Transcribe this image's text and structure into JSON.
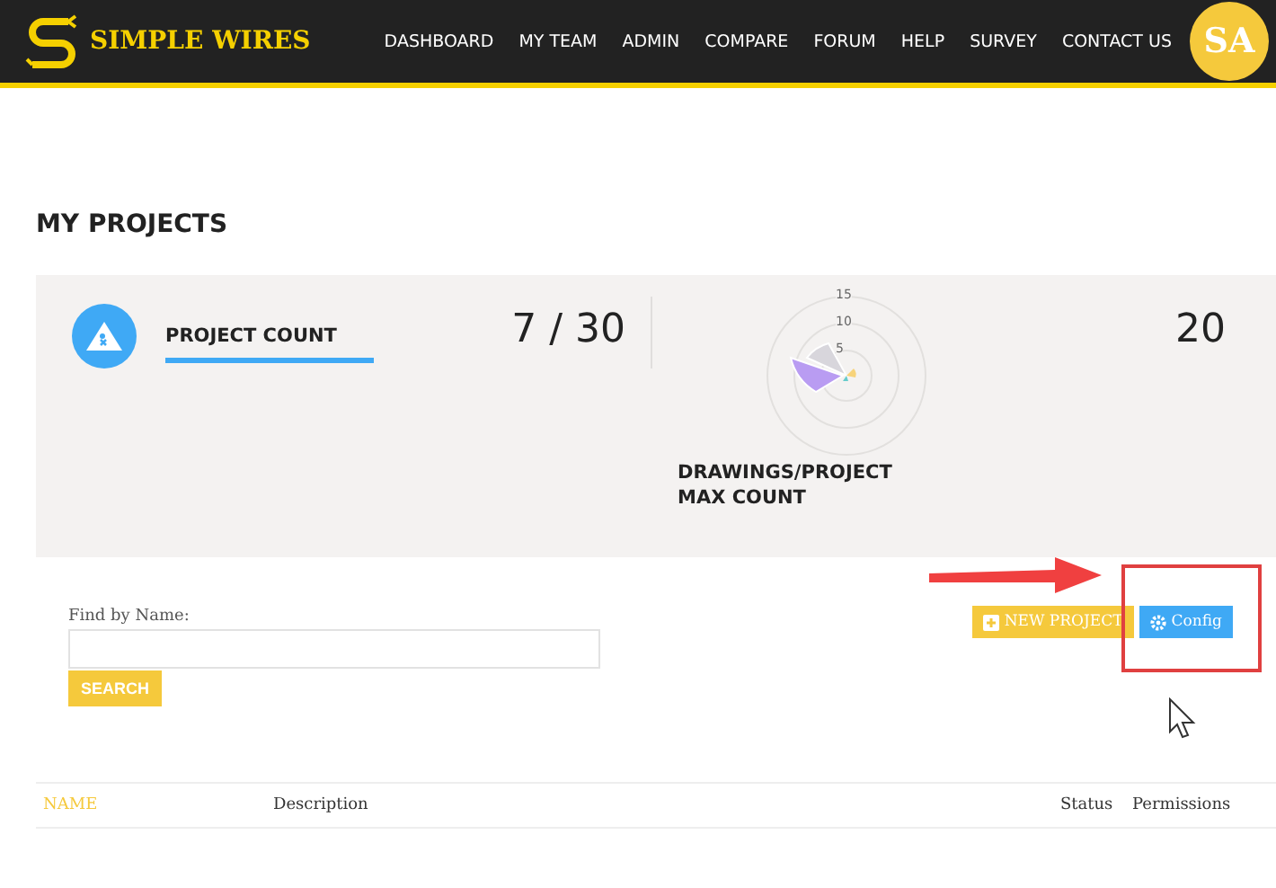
{
  "brand": {
    "name": "SIMPLE WIRES"
  },
  "nav": [
    {
      "label": "DASHBOARD"
    },
    {
      "label": "MY TEAM"
    },
    {
      "label": "ADMIN"
    },
    {
      "label": "COMPARE"
    },
    {
      "label": "FORUM"
    },
    {
      "label": "HELP"
    },
    {
      "label": "SURVEY"
    },
    {
      "label": "CONTACT US"
    }
  ],
  "avatar": {
    "initials": "SA"
  },
  "page_title": "MY PROJECTS",
  "stats": {
    "project_count": {
      "label": "PROJECT COUNT",
      "value": "7 / 30"
    },
    "drawings": {
      "label": "DRAWINGS/PROJECT MAX COUNT",
      "value": "20",
      "ring_labels": [
        "15",
        "10",
        "5"
      ]
    }
  },
  "search": {
    "label": "Find by Name:",
    "button": "SEARCH"
  },
  "actions": [
    {
      "kind": "new",
      "label": "NEW PROJECT"
    },
    {
      "kind": "config",
      "label": "Config"
    }
  ],
  "table": {
    "columns": [
      "NAME",
      "Description",
      "Status",
      "Permissions"
    ]
  }
}
